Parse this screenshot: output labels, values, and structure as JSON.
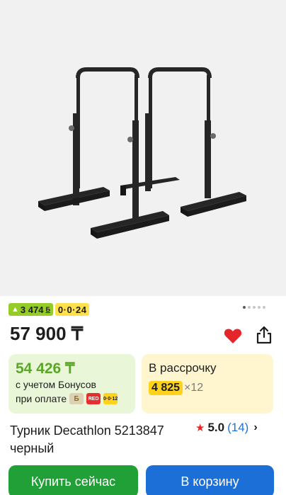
{
  "product": {
    "title": "Турник Decathlon 5213847 черный",
    "price": "57 900 ₸"
  },
  "badges": {
    "bonus": "3 474",
    "bonus_currency": "Б",
    "installment": "0·0·24"
  },
  "gallery": {
    "slide_count": 5,
    "active_slide": 1
  },
  "bonus_offer": {
    "price": "54 426 ₸",
    "line1": "с учетом Бонусов",
    "line2": "при оплате",
    "pay_badges": [
      "Б",
      "RED",
      "0·0·12"
    ]
  },
  "installment_offer": {
    "label": "В рассрочку",
    "amount": "4 825",
    "months": "×12"
  },
  "rating": {
    "value": "5.0",
    "count": "(14)"
  },
  "actions": {
    "buy_now": "Купить сейчас",
    "add_to_cart": "В корзину"
  },
  "icons": {
    "favorite": "heart-icon",
    "share": "share-icon",
    "rating": "star-icon",
    "more": "chevron-right-icon"
  },
  "colors": {
    "heart": "#e4252a",
    "bonus_green": "#5aa626",
    "buy_button": "#21a038",
    "cart_button": "#1b6fd6",
    "installment_yellow": "#ffd21c",
    "link_blue": "#1b74d8"
  }
}
